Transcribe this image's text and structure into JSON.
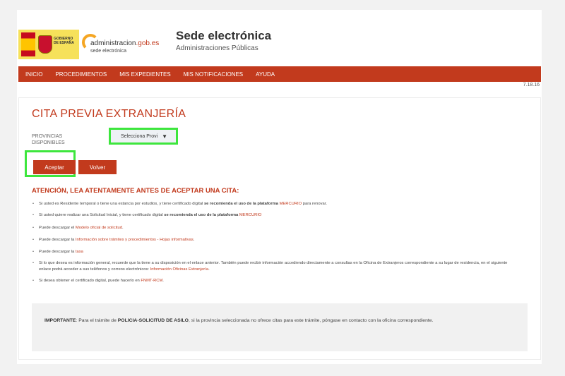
{
  "header": {
    "gov_logo_text": "GOBIERNO DE ESPAÑA",
    "adm_logo_name_a": "administracion",
    "adm_logo_name_b": ".gob.es",
    "adm_logo_sub": "sede electrónica",
    "title": "Sede electrónica",
    "subtitle": "Administraciones Públicas"
  },
  "nav": {
    "items": [
      "INICIO",
      "PROCEDIMIENTOS",
      "MIS EXPEDIENTES",
      "MIS NOTIFICACIONES",
      "AYUDA"
    ]
  },
  "version": "7.18.16",
  "main": {
    "title": "CITA PREVIA EXTRANJERÍA",
    "province_label": "PROVINCIAS DISPONIBLES",
    "province_select_value": "Selecciona Provi",
    "accept_label": "Aceptar",
    "back_label": "Volver",
    "warning": "ATENCIÓN, LEA ATENTAMENTE ANTES DE ACEPTAR UNA CITA:",
    "notes": [
      {
        "pre": "Si usted es Residente temporal o tiene una estancia por estudios, y tiene certificado digital ",
        "strong": "se recomienda el uso de la plataforma ",
        "link": "MERCURIO",
        "post": " para renovar."
      },
      {
        "pre": "Si usted quiere realizar una Solicitud Inicial, y tiene certificado digital ",
        "strong": "se recomienda el uso de la plataforma ",
        "link": "MERCURIO",
        "post": ""
      },
      {
        "pre": "Puede descargar el ",
        "strong": "",
        "link": "Modelo oficial de solicitud",
        "post": "."
      },
      {
        "pre": "Puede descargar la ",
        "strong": "",
        "link": "Información sobre trámites y procedimientos - Hojas informativas",
        "post": "."
      },
      {
        "pre": "Puede descargar la ",
        "strong": "",
        "link": "tasa",
        "post": ""
      },
      {
        "pre": "Si lo que desea es información general, recuerde que la tiene a su disposición en el enlace anterior. También puede recibir información accediendo directamente a consultas en la Oficina de Extranjeros correspondiente a su lugar de residencia, en el siguiente enlace podrá acceder a sus teléfonos y correos electrónicos: ",
        "strong": "",
        "link": "Información Oficinas Extranjería",
        "post": "."
      },
      {
        "pre": "Si desea obtener el certificado digital, puede hacerlo en ",
        "strong": "",
        "link": "FNMT-RCM",
        "post": "."
      }
    ],
    "important": {
      "label": "IMPORTANTE",
      "text_a": ": Para el trámite de ",
      "procedure": "POLICIA-SOLICITUD DE ASILO",
      "text_b": ", si la provincia seleccionada no ofrece citas para este trámite, póngase en contacto con la oficina correspondiente."
    }
  },
  "colors": {
    "brand": "#c23a1d",
    "highlight": "#3de63d"
  }
}
